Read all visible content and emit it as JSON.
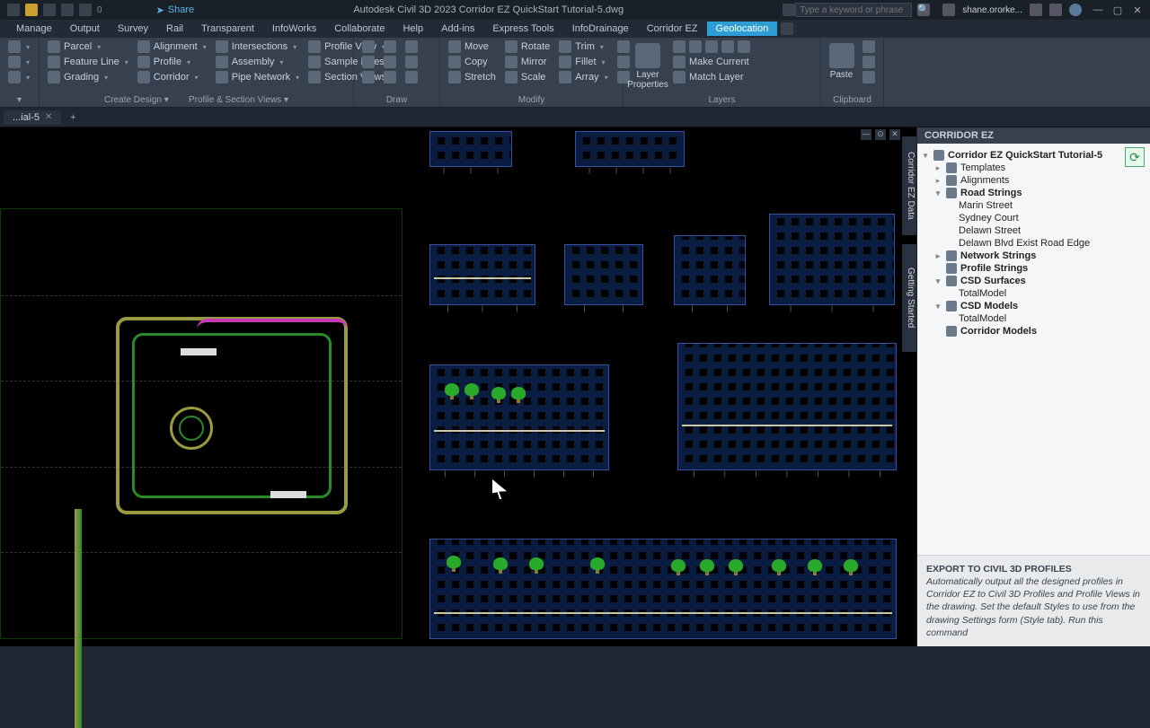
{
  "titlebar": {
    "share": "Share",
    "app_title": "Autodesk Civil 3D 2023   Corridor EZ QuickStart Tutorial-5.dwg",
    "search_placeholder": "Type a keyword or phrase",
    "account": "shane.ororke..."
  },
  "menubar": {
    "items": [
      "Manage",
      "Output",
      "Survey",
      "Rail",
      "Transparent",
      "InfoWorks",
      "Collaborate",
      "Help",
      "Add-ins",
      "Express Tools",
      "InfoDrainage",
      "Corridor EZ"
    ],
    "active": "Geolocation"
  },
  "ribbon": {
    "p1": {
      "b1": "Parcel",
      "b2": "Feature Line",
      "b3": "Grading",
      "b4": "Alignment",
      "b5": "Intersections",
      "b6": "Profile",
      "b7": "Corridor",
      "b8": "Assembly",
      "b9": "Pipe Network",
      "b10": "Profile View",
      "b11": "Sample Lines",
      "b12": "Section Views",
      "title1": "Create Design",
      "title2": "Profile & Section Views"
    },
    "draw": {
      "title": "Draw"
    },
    "mod": {
      "b1": "Move",
      "b2": "Copy",
      "b3": "Stretch",
      "b4": "Rotate",
      "b5": "Mirror",
      "b6": "Scale",
      "b7": "Trim",
      "b8": "Fillet",
      "b9": "Array",
      "title": "Modify"
    },
    "layer": {
      "b1": "Layer Properties",
      "b2": "Make Current",
      "b3": "Match Layer",
      "title": "Layers"
    },
    "clip": {
      "b1": "Paste",
      "title": "Clipboard"
    }
  },
  "doctab": {
    "name": "...ial-5",
    "plus": "+"
  },
  "palette": {
    "vtab": "Corridor EZ Data",
    "vtab2": "Getting Started"
  },
  "sidepanel": {
    "title": "CORRIDOR EZ",
    "root": "Corridor EZ QuickStart Tutorial-5",
    "templates": "Templates",
    "alignments": "Alignments",
    "roadstrings": "Road Strings",
    "rs1": "Marin Street",
    "rs2": "Sydney Court",
    "rs3": "Delawn Street",
    "rs4": "Delawn Blvd Exist Road Edge",
    "netstrings": "Network Strings",
    "profstrings": "Profile Strings",
    "csdsurf": "CSD Surfaces",
    "tm1": "TotalModel",
    "csdmod": "CSD Models",
    "tm2": "TotalModel",
    "corrmod": "Corridor Models",
    "help_title": "EXPORT TO CIVIL 3D PROFILES",
    "help_body": "Automatically output all the designed profiles in Corridor EZ to Civil 3D Profiles and Profile Views in the drawing. Set the default Styles to use from the drawing Settings form (Style tab). Run this command"
  }
}
